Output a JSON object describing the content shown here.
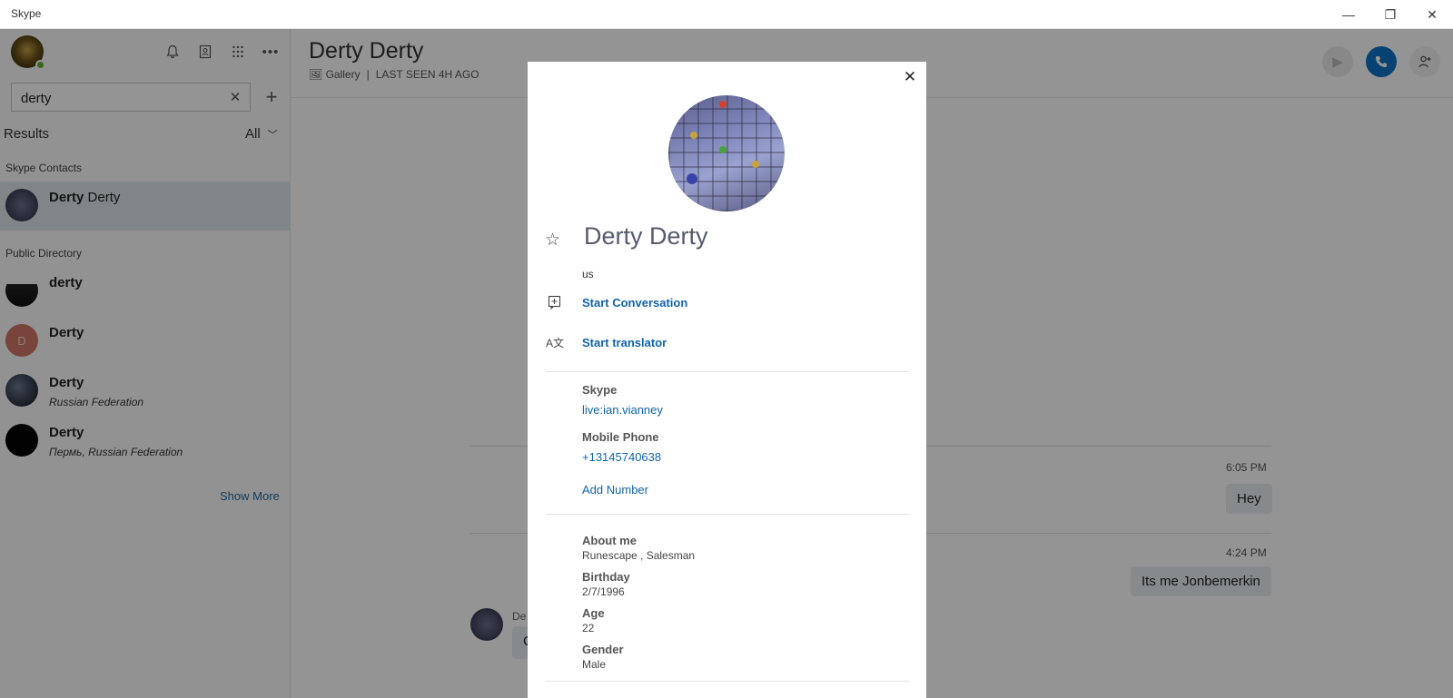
{
  "window": {
    "title": "Skype"
  },
  "sidebar": {
    "search": {
      "value": "derty"
    },
    "results_label": "Results",
    "filter_label": "All",
    "skype_contacts_label": "Skype Contacts",
    "public_directory_label": "Public Directory",
    "contacts": [
      {
        "first": "Derty",
        "last": " Derty",
        "sub": ""
      }
    ],
    "directory": [
      {
        "first": "derty",
        "last": "",
        "sub": ""
      },
      {
        "first": "Derty",
        "last": "",
        "sub": "",
        "initial": "D"
      },
      {
        "first": "Derty",
        "last": "",
        "sub": "Russian Federation"
      },
      {
        "first": "Derty",
        "last": "",
        "sub": "Пермь, Russian Federation"
      }
    ],
    "show_more": "Show More"
  },
  "chat": {
    "name": "Derty Derty",
    "gallery": "Gallery",
    "last_seen": "LAST SEEN 4H AGO",
    "messages": [
      {
        "time": "6:05 PM",
        "text": "Hey"
      },
      {
        "time": "4:24 PM",
        "text": "Its me Jonbemerkin"
      }
    ],
    "partial_sender": "De",
    "partial_text": "C"
  },
  "profile": {
    "name": "Derty Derty",
    "location": "us",
    "start_conversation": "Start Conversation",
    "start_translator": "Start translator",
    "skype_label": "Skype",
    "skype_id": "live:ian.vianney",
    "mobile_label": "Mobile Phone",
    "mobile_number": "+13145740638",
    "add_number": "Add Number",
    "about_label": "About me",
    "about_value": "Runescape , Salesman",
    "birthday_label": "Birthday",
    "birthday_value": "2/7/1996",
    "age_label": "Age",
    "age_value": "22",
    "gender_label": "Gender",
    "gender_value": "Male"
  },
  "colors": {
    "accent": "#1063ad",
    "call_button": "#0e73c6",
    "presence_online": "#5fb336",
    "selected_row": "#dce6ea"
  }
}
